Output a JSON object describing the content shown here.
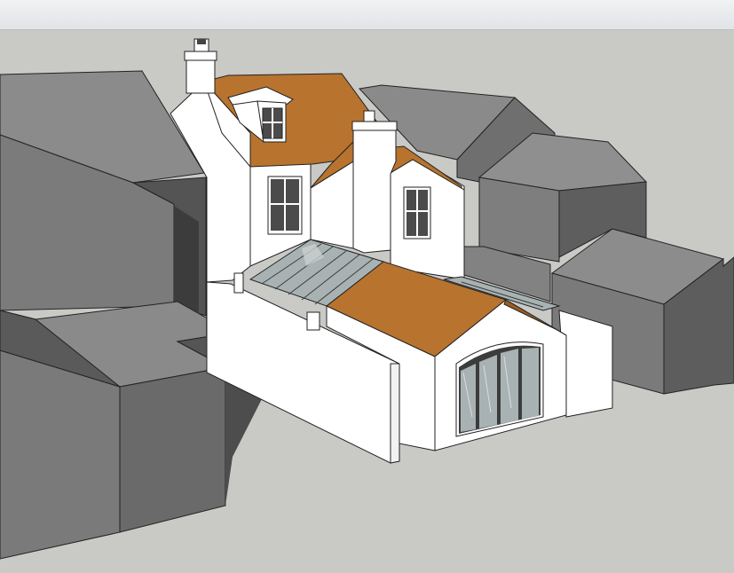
{
  "app": {
    "viewport_background": "#c9cac6",
    "toolbar_background": "#e8eaed"
  },
  "model": {
    "description_colors": {
      "neighbour_dark": "#4a4a4a",
      "neighbour_mid": "#6b6b6b",
      "neighbour_light": "#8a8a8a",
      "neighbour_roof": "#777777",
      "wall": "#ffffff",
      "roof": "#b8732f",
      "roof_dark": "#9a5d24",
      "glass": "#a8b2b3",
      "glazing_frame": "#3c3c3c",
      "shadow": "#4d4d4d"
    },
    "objects": [
      "neighbour-building-left",
      "neighbour-building-front-left",
      "neighbour-building-back-right",
      "neighbour-building-right",
      "neighbour-building-far-right",
      "main-house",
      "chimney-left",
      "chimney-right",
      "dormer-window",
      "rear-extension",
      "bifold-doors",
      "glass-roof-link",
      "boundary-wall"
    ]
  }
}
